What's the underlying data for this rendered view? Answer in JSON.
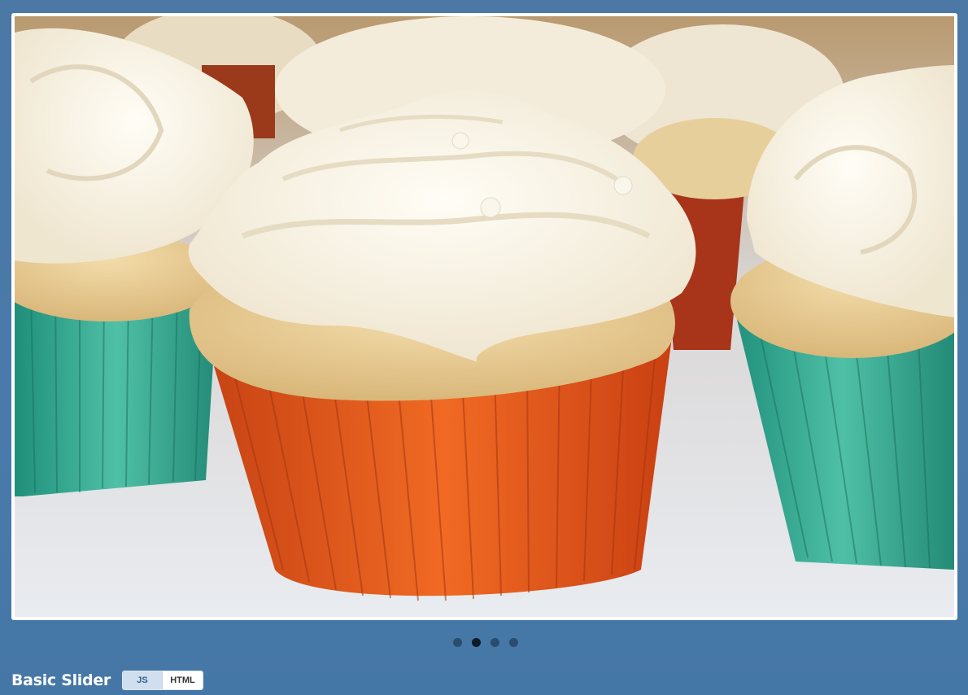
{
  "slider": {
    "image_alt": "Cupcakes with white frosting in orange and teal liners",
    "slide_count": 4,
    "active_index": 1
  },
  "footer": {
    "title": "Basic Slider",
    "toggle": {
      "js_label": "JS",
      "html_label": "HTML",
      "active": "JS"
    }
  },
  "colors": {
    "background": "#4a7aaa",
    "frame": "#ffffff",
    "dot": "#2a4d6d",
    "dot_active": "#0d1b28",
    "toggle_active": "#cfdff0"
  }
}
